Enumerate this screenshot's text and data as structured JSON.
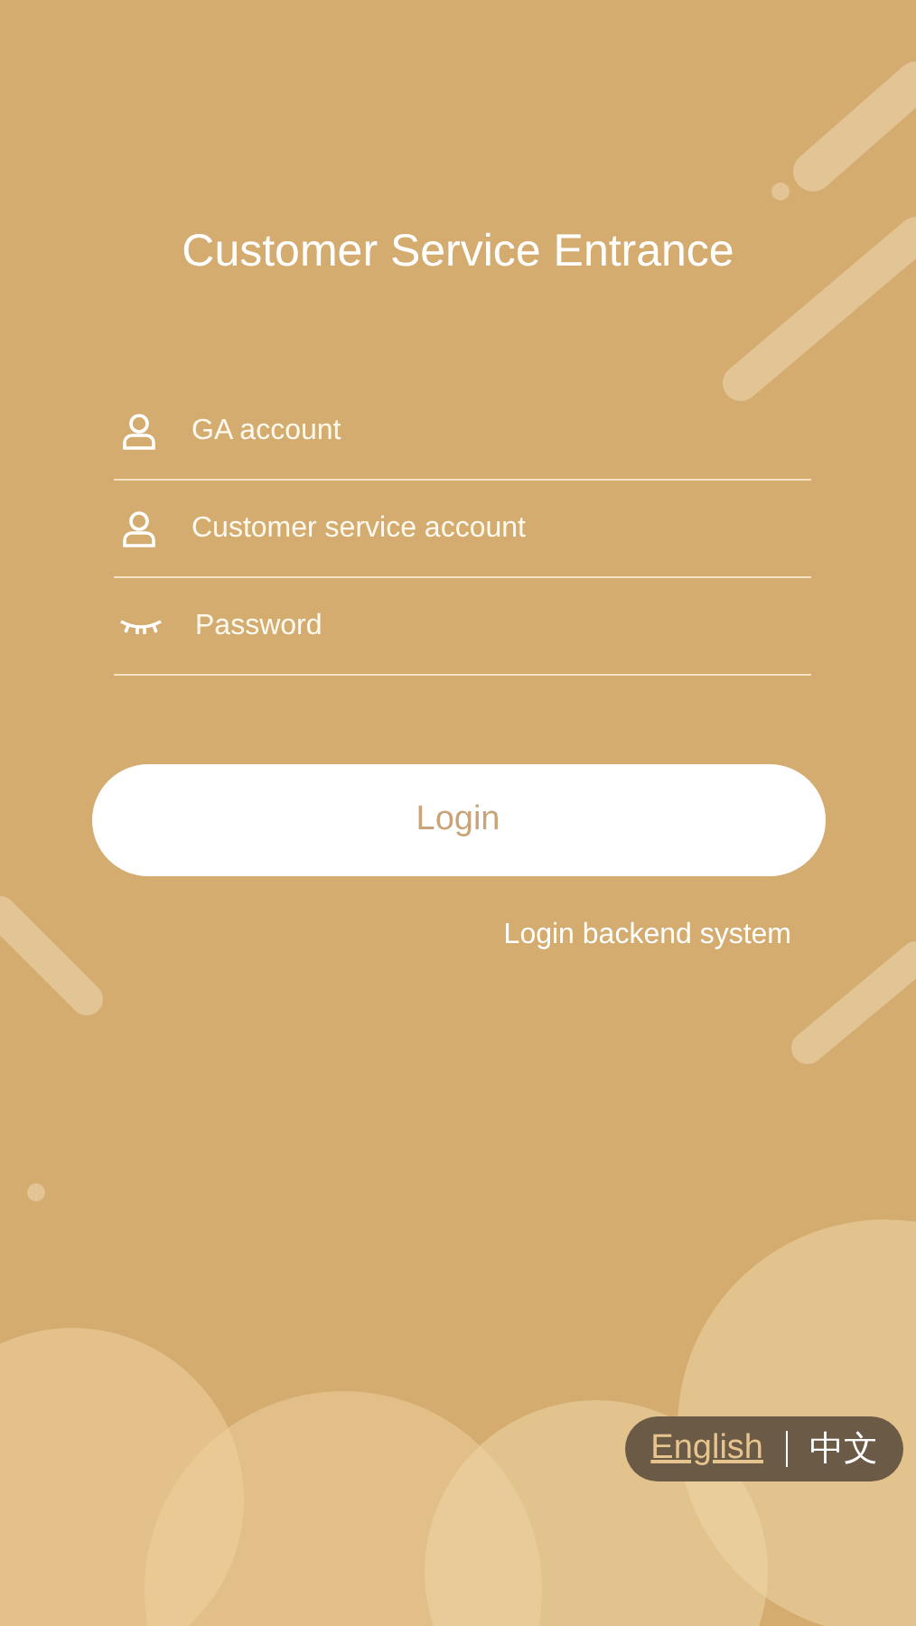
{
  "title": "Customer Service Entrance",
  "fields": [
    {
      "kind": "person",
      "placeholder": "GA account"
    },
    {
      "kind": "person",
      "placeholder": "Customer service account"
    },
    {
      "kind": "eye",
      "placeholder": "Password"
    }
  ],
  "login_button": "Login",
  "backend_link": "Login backend system",
  "languages": [
    {
      "label": "English",
      "selected": true
    },
    {
      "label": "中文",
      "selected": false
    }
  ]
}
